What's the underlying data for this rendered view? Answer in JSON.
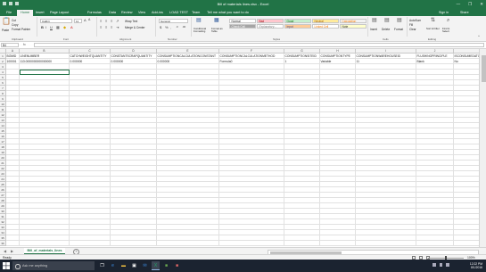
{
  "window": {
    "title": "Bill of materials lines.xlsx - Excel",
    "controls": {
      "minimize": "—",
      "restore": "❐",
      "close": "✕"
    }
  },
  "ribbon_tabs": [
    "File",
    "Home",
    "Insert",
    "Page Layout",
    "Formulas",
    "Data",
    "Review",
    "View",
    "Add-ins",
    "LOAD TEST",
    "Team"
  ],
  "active_tab": "Home",
  "tell_me": "Tell me what you want to do",
  "header_right": {
    "signin": "Sign in",
    "share": "Share"
  },
  "ribbon": {
    "clipboard": {
      "paste": "Paste",
      "cut": "Cut",
      "copy": "Copy",
      "format_painter": "Format Painter",
      "label": "Clipboard"
    },
    "font": {
      "name": "Calibri",
      "size": "11",
      "label": "Font"
    },
    "alignment": {
      "wrap": "Wrap Text",
      "merge": "Merge & Center",
      "label": "Alignment"
    },
    "number": {
      "format": "General",
      "currency": "$",
      "percent": "%",
      "label": "Number"
    },
    "styles": {
      "conditional": "Conditional Formatting",
      "table": "Format as Table",
      "items": [
        "Normal",
        "Bad",
        "Good",
        "Neutral",
        "Calculation",
        "Check Cell",
        "Explanatory...",
        "Input",
        "Linked Cell",
        "Note"
      ],
      "colors": {
        "bad": "#ffc7ce",
        "good": "#c6efce",
        "neutral": "#ffeb9c",
        "calculation": "#f2f2f2",
        "check": "#a5a5a5",
        "input": "#ffcc99"
      },
      "label": "Styles"
    },
    "cells": {
      "insert": "Insert",
      "delete": "Delete",
      "format": "Format",
      "label": "Cells"
    },
    "editing": {
      "autosum": "AutoSum",
      "fill": "Fill",
      "clear": "Clear",
      "sort": "Sort & Filter",
      "find": "Find & Select",
      "label": "Editing"
    }
  },
  "formula_bar": {
    "name_box": "B4",
    "fx": "fx",
    "content": ""
  },
  "columns": [
    "A",
    "B",
    "C",
    "D",
    "E",
    "F",
    "G",
    "H",
    "I",
    "J",
    "K"
  ],
  "rows": [
    "1",
    "2",
    "3",
    "4",
    "5",
    "6",
    "7",
    "8",
    "9",
    "10",
    "11",
    "12",
    "13",
    "14",
    "15",
    "16",
    "17",
    "18",
    "19",
    "20",
    "21",
    "22",
    "23",
    "24",
    "25",
    "26",
    "27",
    "28",
    "29",
    "30",
    "31",
    "32",
    "33",
    "34",
    "35",
    "36"
  ],
  "cells": {
    "row1": [
      "BOMID",
      "LINENUMBER",
      "CATCHWEIGHTQUANTITY",
      "CONSTANTSCRAPQUANTITY",
      "CONSUMPTIONCALCULATIONCONSTANT",
      "CONSUMPTIONCALCULATIONMETHOD",
      "CONSUMPTIONSITEID",
      "CONSUMPTIONTYPE",
      "CONSUMPTIONWAREHOUSEID",
      "FLUSHINGPRINCIPLE",
      "ISCONSUMEDATOPERATIONCOMPLETE"
    ],
    "row2": [
      "100001",
      "113.0000000000000000",
      "0.000000",
      "0.000000",
      "0.000000",
      "Formula0",
      "1",
      "Variable",
      "11",
      "Blank",
      "No"
    ]
  },
  "sheet": {
    "name": "Bill_of_materials_lines",
    "add": "+"
  },
  "status": {
    "ready": "Ready",
    "zoom": "100%"
  },
  "taskbar": {
    "search": "Ask me anything",
    "apps": [
      "task-view",
      "edge",
      "file-explorer",
      "store",
      "mail",
      "excel",
      "app",
      "app"
    ],
    "time": "12:22 PM",
    "date": "8/1/2016"
  }
}
